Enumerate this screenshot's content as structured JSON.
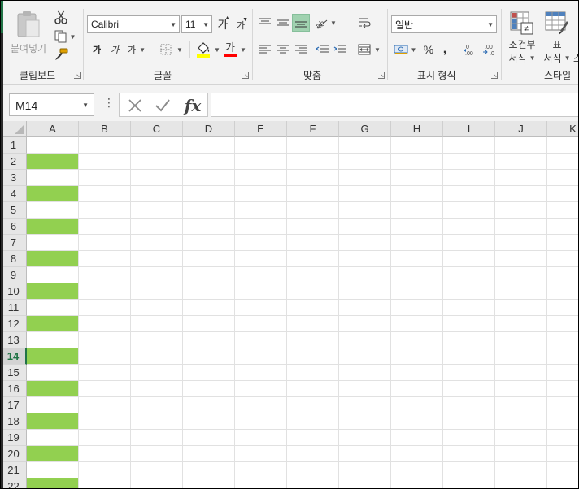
{
  "ribbon": {
    "clipboard": {
      "label": "클립보드",
      "paste_label": "붙여넣기"
    },
    "font": {
      "label": "글꼴",
      "font_name": "Calibri",
      "font_size": "11",
      "grow_label": "가",
      "shrink_label": "가",
      "bold_label": "가",
      "italic_label": "가",
      "underline_label": "가",
      "font_color_label": "가",
      "fill_color": "#FFFF00",
      "font_color": "#FF0000"
    },
    "alignment": {
      "label": "맞춤"
    },
    "number": {
      "label": "표시 형식",
      "format": "일반",
      "percent": "%",
      "comma": ","
    },
    "styles": {
      "label": "스타일",
      "conditional_line1": "조건부",
      "conditional_line2": "서식",
      "table_line1": "표",
      "table_line2": "서식",
      "cell_styles": "스"
    }
  },
  "formula_bar": {
    "name_box": "M14",
    "dots": "⋮",
    "fx": "fx",
    "formula": ""
  },
  "sheet": {
    "columns": [
      "A",
      "B",
      "C",
      "D",
      "E",
      "F",
      "G",
      "H",
      "I",
      "J",
      "K"
    ],
    "rows": [
      "1",
      "2",
      "3",
      "4",
      "5",
      "6",
      "7",
      "8",
      "9",
      "10",
      "11",
      "12",
      "13",
      "14",
      "15",
      "16",
      "17",
      "18",
      "19",
      "20",
      "21",
      "22"
    ],
    "active_row": "14",
    "fill_color": "#92D050",
    "filled_rows_in_column_A": [
      "2",
      "4",
      "6",
      "8",
      "10",
      "12",
      "14",
      "16",
      "18",
      "20",
      "22"
    ]
  },
  "colors": {
    "excel_green": "#217346",
    "ribbon_bg": "#F3F3F3"
  }
}
